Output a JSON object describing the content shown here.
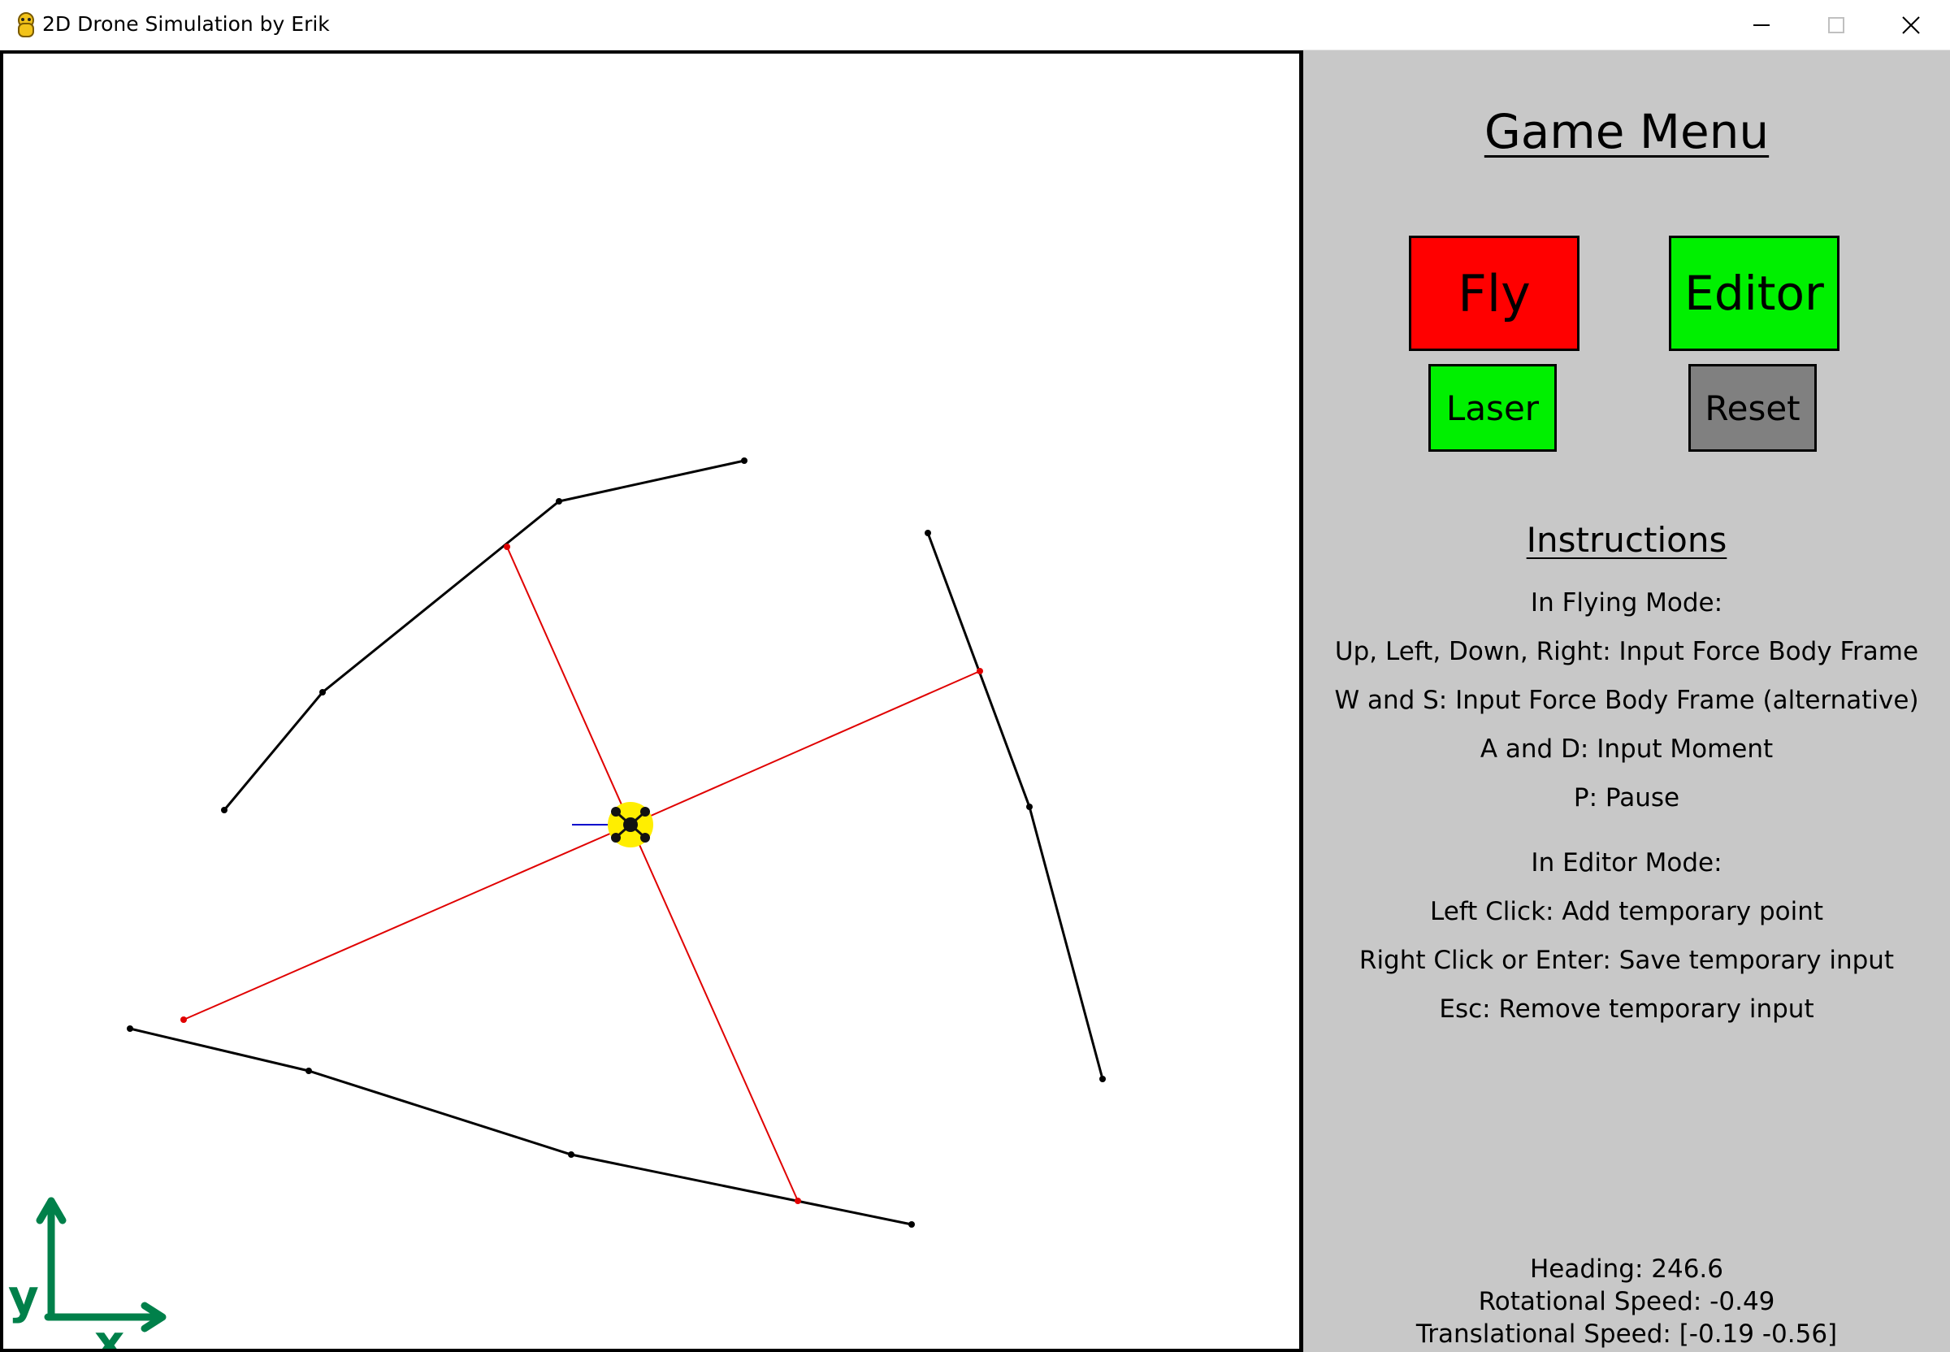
{
  "window": {
    "title": "2D Drone Simulation by Erik",
    "app_icon": "python-snake-icon",
    "controls": [
      "minimize-icon",
      "maximize-icon",
      "close-icon"
    ]
  },
  "colors": {
    "wall": "#000000",
    "laser": "#e00000",
    "drone_body": "#ffee00",
    "heading_line": "#0000cc",
    "axes": "#00804a",
    "panel_bg": "#c8c8c8",
    "fly_button": "#ff0000",
    "editor_button": "#00f000",
    "laser_button": "#00f000",
    "reset_button": "#808080"
  },
  "menu": {
    "title": "Game Menu",
    "buttons": {
      "fly": "Fly",
      "editor": "Editor",
      "laser": "Laser",
      "reset": "Reset"
    }
  },
  "instructions": {
    "title": "Instructions",
    "flying_header": "In Flying Mode:",
    "flying": [
      "Up, Left, Down, Right: Input Force Body Frame",
      "W and S: Input Force Body Frame (alternative)",
      "A and D: Input Moment",
      "P: Pause"
    ],
    "editor_header": "In Editor Mode:",
    "editor": [
      "Left Click: Add temporary point",
      "Right Click or Enter: Save temporary input",
      "Esc: Remove temporary input"
    ]
  },
  "status": {
    "heading": "Heading: 246.6",
    "rotational_speed": "Rotational Speed: -0.49",
    "translational_speed": "Translational Speed: [-0.19 -0.56]"
  },
  "axes_labels": {
    "x": "x",
    "y": "y"
  }
}
